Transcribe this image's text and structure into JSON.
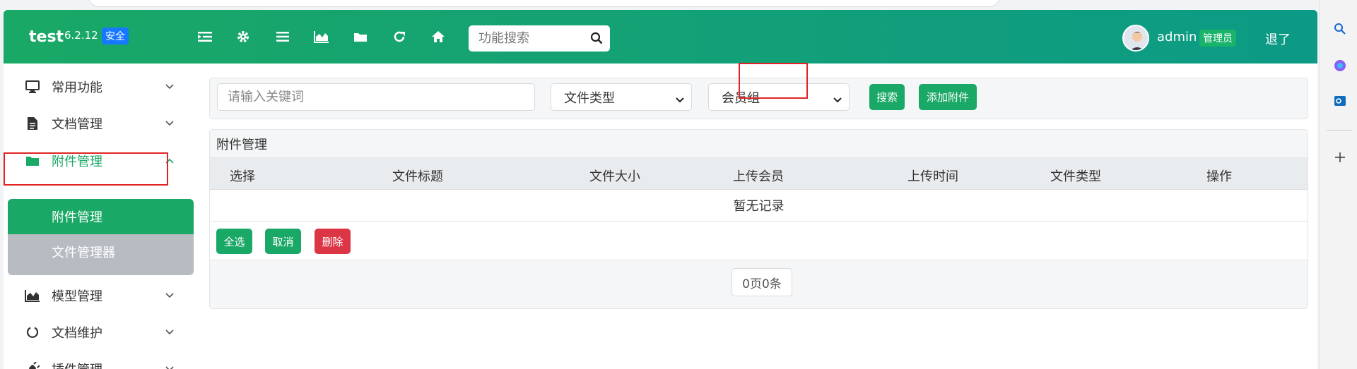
{
  "app": {
    "name": "test",
    "version": "6.2.12",
    "safe_badge": "安全"
  },
  "header": {
    "search_placeholder": "功能搜索",
    "username": "admin",
    "role": "管理员",
    "logout": "退了"
  },
  "sidebar": {
    "items": [
      {
        "label": "常用功能",
        "icon": "monitor-icon"
      },
      {
        "label": "文档管理",
        "icon": "document-icon"
      },
      {
        "label": "附件管理",
        "icon": "folder-icon"
      },
      {
        "label": "模型管理",
        "icon": "area-chart-icon"
      },
      {
        "label": "文档维护",
        "icon": "circle-notch-icon"
      },
      {
        "label": "插件管理",
        "icon": "plug-icon"
      }
    ],
    "submenu": [
      {
        "label": "附件管理"
      },
      {
        "label": "文件管理器"
      }
    ]
  },
  "filter": {
    "keyword_placeholder": "请输入关键词",
    "file_type_selected": "文件类型",
    "member_group_selected": "会员组",
    "search_button": "搜索",
    "add_button": "添加附件"
  },
  "table": {
    "title": "附件管理",
    "columns": [
      "选择",
      "文件标题",
      "文件大小",
      "上传会员",
      "上传时间",
      "文件类型",
      "操作"
    ],
    "empty_text": "暂无记录",
    "actions": {
      "select_all": "全选",
      "cancel": "取消",
      "delete": "删除"
    },
    "pagination": "0页0条"
  },
  "colors": {
    "primary": "#1aa866",
    "danger": "#dc3545",
    "header_gradient_start": "#1aa866",
    "header_gradient_end": "#0c9a86",
    "badge_blue": "#1677ff",
    "highlight_red": "#e02424"
  }
}
